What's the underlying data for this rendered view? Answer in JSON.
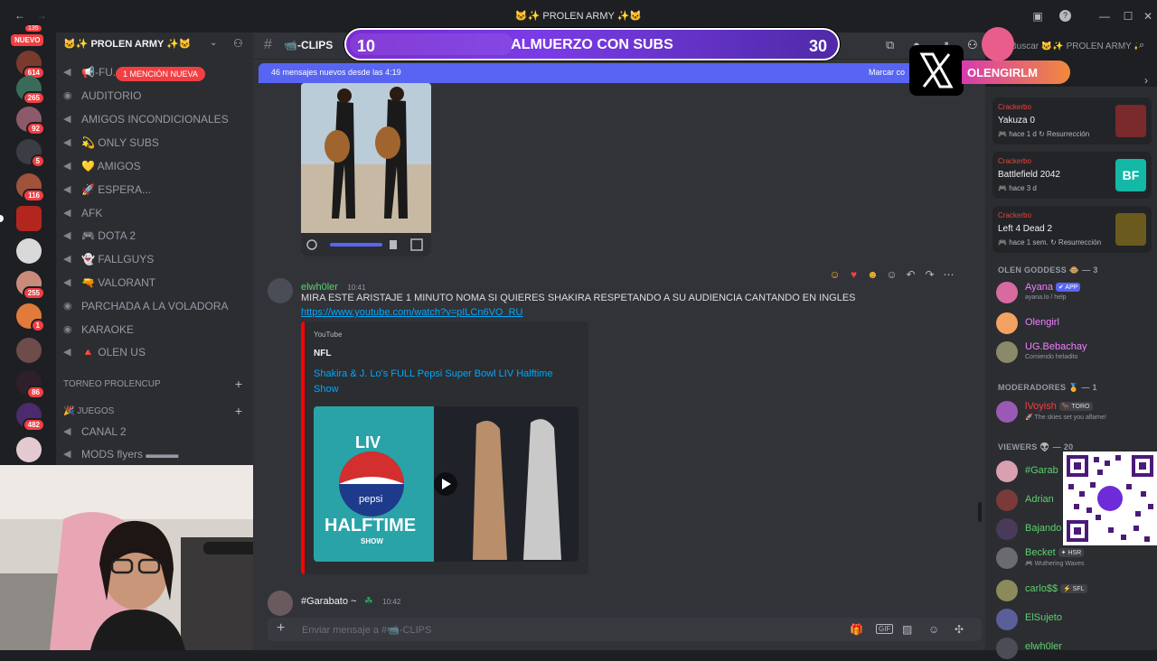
{
  "window": {
    "title": "🐱✨ PROLEN ARMY ✨🐱"
  },
  "rail": {
    "new_label": "NUEVO",
    "badges": [
      "135",
      "614",
      "265",
      "92",
      "5",
      "116",
      "255",
      "1",
      "86",
      "482"
    ]
  },
  "sidebar": {
    "guild_name": "🐱✨ PROLEN ARMY ✨🐱",
    "mention_pill": "1 MENCIÓN NUEVA",
    "channels": [
      {
        "label": "📢-FU...",
        "icon": "speaker-icon"
      },
      {
        "label": "AUDITORIO",
        "icon": "stage-icon"
      },
      {
        "label": "AMIGOS INCONDICIONALES",
        "icon": "speaker-icon"
      },
      {
        "label": "💫 ONLY SUBS",
        "icon": "speaker-icon"
      },
      {
        "label": "💛 AMIGOS",
        "icon": "speaker-icon"
      },
      {
        "label": "🚀 ESPERA...",
        "icon": "speaker-icon"
      },
      {
        "label": "AFK",
        "icon": "speaker-icon"
      },
      {
        "label": "🎮 DOTA 2",
        "icon": "speaker-icon"
      },
      {
        "label": "👻 FALLGUYS",
        "icon": "speaker-icon"
      },
      {
        "label": "🔫 VALORANT",
        "icon": "speaker-icon"
      },
      {
        "label": "PARCHADA A LA VOLADORA",
        "icon": "stage-icon"
      },
      {
        "label": "KARAOKE",
        "icon": "stage-icon"
      },
      {
        "label": "🔺 OLEN US",
        "icon": "speaker-icon"
      }
    ],
    "category_torneo": "TORNEO PROLENCUP",
    "category_juegos": "🎉 JUEGOS",
    "channels2": [
      {
        "label": "CANAL 2"
      },
      {
        "label": "MODS flyers ▬▬▬"
      }
    ]
  },
  "chat": {
    "channel_name": "📹-CLIPS",
    "new_messages": "46 mensajes nuevos desde las 4:19",
    "mark_read": "Marcar co",
    "message1": {
      "author": "elwh0ler",
      "time": "10:41",
      "text": "MIRA ESTE ARISTAJE 1 MINUTO NOMA SI QUIERES SHAKIRA RESPETANDO A SU AUDIENCIA CANTANDO EN INGLES",
      "link": "https://www.youtube.com/watch?v=pILCn6VO_RU"
    },
    "embed": {
      "provider": "YouTube",
      "author": "NFL",
      "title": "Shakira & J. Lo's FULL Pepsi Super Bowl LIV Halftime Show",
      "thumb_text_top": "LIV",
      "thumb_text_mid": "pepsi",
      "thumb_text_bottom": "HALFTIME",
      "thumb_text_show": "SHOW"
    },
    "message2": {
      "author": "#Garabato ~",
      "time": "10:42"
    },
    "composer_placeholder": "Enviar mensaje a #📹-CLIPS",
    "search_placeholder": "Buscar 🐱✨ PROLEN ARMY ✨🐱"
  },
  "stream_overlay": {
    "current": "10",
    "goal_text": "ALMUERZO CON SUBS",
    "target": "30",
    "progress": 0.333,
    "brand": "OLENGIRLM"
  },
  "members": {
    "activities": [
      {
        "user": "Crackerbo",
        "game": "Yakuza 0",
        "time": "hace 1 d",
        "extra": "Resurrección"
      },
      {
        "user": "Crackerbo",
        "game": "Battlefield 2042",
        "time": "hace 3 d",
        "extra": ""
      },
      {
        "user": "Crackerbo",
        "game": "Left 4 Dead 2",
        "time": "hace 1 sem.",
        "extra": "Resurrección"
      }
    ],
    "roles": [
      {
        "title": "OLEN GODDESS 🐵 — 3",
        "members": [
          {
            "name": "Ayana",
            "tag": "✔ APP",
            "sub": "ayana.lo / help",
            "color": "#f47fff"
          },
          {
            "name": "Olengirl",
            "tag": "",
            "sub": "",
            "color": "#f47fff"
          },
          {
            "name": "UG.Bebachay",
            "tag": "",
            "sub": "Comiendo heladito",
            "color": "#f47fff"
          }
        ]
      },
      {
        "title": "MODERADORES 🏅 — 1",
        "members": [
          {
            "name": "lVoyish",
            "tag": "🐂 TORO",
            "sub": "🚀 The skies set you aflame!",
            "color": "#f23f43"
          }
        ]
      },
      {
        "title": "VIEWERS 👽 — 20",
        "members": [
          {
            "name": "#Garab",
            "tag": "",
            "sub": "",
            "color": "#5cd16d"
          },
          {
            "name": "Adrian",
            "tag": "",
            "sub": "",
            "color": "#5cd16d"
          },
          {
            "name": "Bajando",
            "tag": "",
            "sub": "",
            "color": "#5cd16d"
          },
          {
            "name": "Becket",
            "tag": "✦ HSR",
            "sub": "🎮 Wuthering Waves",
            "color": "#5cd16d"
          },
          {
            "name": "carlo$$",
            "tag": "⚡ SFL",
            "sub": "",
            "color": "#5cd16d"
          },
          {
            "name": "ElSujeto",
            "tag": "",
            "sub": "",
            "color": "#5cd16d"
          },
          {
            "name": "elwh0ler",
            "tag": "",
            "sub": "",
            "color": "#5cd16d"
          }
        ]
      }
    ]
  },
  "colors": {
    "blurple": "#5865f2",
    "online": "#23a55a",
    "danger": "#f23f43",
    "link": "#00a8fc"
  }
}
